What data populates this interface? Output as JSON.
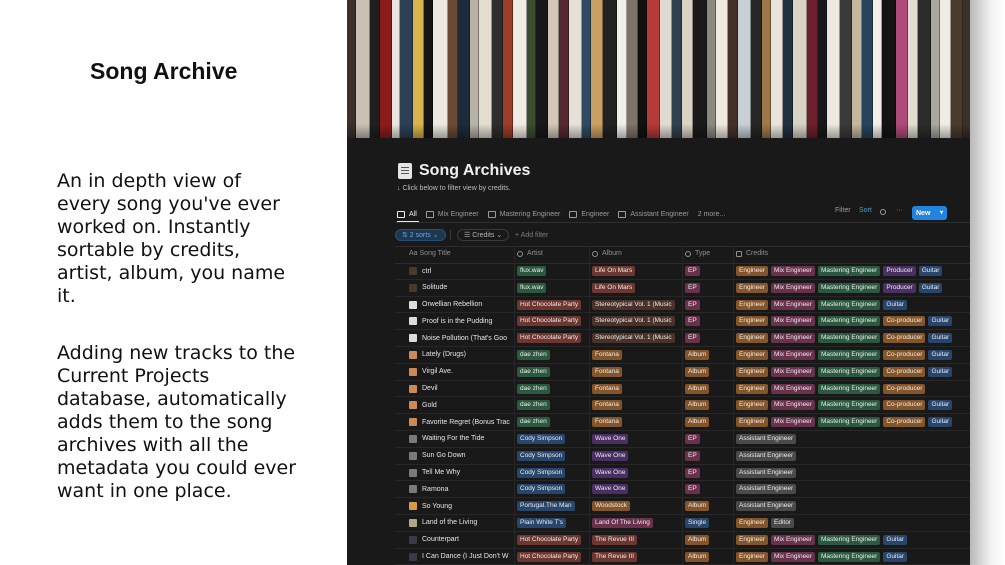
{
  "slide": {
    "title": "Song Archive",
    "paragraph1": "An in depth view of every song you've ever worked on. Instantly sortable by credits, artist, album, you name it.",
    "paragraph2": "Adding new tracks to the Current Projects database, automatically adds them to the song archives with all the metadata you could ever want in one place."
  },
  "cover": {
    "spine_colors": [
      "#3d2f2a",
      "#c9c2b4",
      "#1f1f1f",
      "#8c1c1c",
      "#e9e6df",
      "#2b3f55",
      "#d8b24a",
      "#141414",
      "#ede9e0",
      "#6b4a34",
      "#1c2b3a",
      "#b8b2a6",
      "#e3ddd0",
      "#2d2d2d",
      "#9e3d2a",
      "#f0ece4",
      "#3b4d2f",
      "#181818",
      "#d2c8b7",
      "#572832",
      "#e6e1d7",
      "#2f4a62",
      "#c8a064",
      "#222222",
      "#f1efe9",
      "#7e7467",
      "#111111",
      "#b63a3a",
      "#e0dbd1",
      "#30424f",
      "#dad2c4",
      "#1a1a1a",
      "#8a8a80",
      "#efe9df",
      "#44322a",
      "#c7cfd5",
      "#262626",
      "#9c7a48",
      "#e8e4dc",
      "#1f3040",
      "#d9d3c6",
      "#6e1f2b",
      "#191919",
      "#ede8e0",
      "#3a3a3a",
      "#c3b79f",
      "#27445c",
      "#f2efe8",
      "#141414",
      "#b04a7a",
      "#e2ddd3",
      "#2c2c2c",
      "#a8a8a0",
      "#f0ebe3",
      "#4b3b2d"
    ]
  },
  "page": {
    "title": "Song Archives",
    "subtitle": "↓ Click below to filter view by credits.",
    "tabs": [
      "All",
      "Mix Engineer",
      "Mastering Engineer",
      "Engineer",
      "Assistant Engineer",
      "2 more..."
    ],
    "toolbar": {
      "filter": "Filter",
      "sort": "Sort",
      "more": "···",
      "new": "New"
    },
    "chips": {
      "sorts": "⇅ 2 sorts ⌄",
      "credits": "☰ Credits ⌄",
      "add_filter": "+ Add filter"
    },
    "columns": {
      "title": "Aa Song Title",
      "artist": "Artist",
      "album": "Album",
      "type": "Type",
      "credits": "Credits"
    }
  },
  "colors": {
    "red": "#6e3630",
    "orange": "#85552a",
    "blue": "#28456c",
    "green": "#2b593f",
    "purple": "#492f64",
    "pink": "#69314c",
    "brown": "#4a3228",
    "gray": "#4a4a4a"
  },
  "rows": [
    {
      "title": "ctrl",
      "icon": "#4a3a2a",
      "artist": {
        "t": "flux.wav",
        "c": "green"
      },
      "album": {
        "t": "Life On Mars",
        "c": "red"
      },
      "type": {
        "t": "EP",
        "c": "pink"
      },
      "credits": [
        {
          "t": "Engineer",
          "c": "orange"
        },
        {
          "t": "Mix Engineer",
          "c": "pink"
        },
        {
          "t": "Mastering Engineer",
          "c": "green"
        },
        {
          "t": "Producer",
          "c": "purple"
        },
        {
          "t": "Guitar",
          "c": "blue"
        }
      ]
    },
    {
      "title": "Solitude",
      "icon": "#4a3a2a",
      "artist": {
        "t": "flux.wav",
        "c": "green"
      },
      "album": {
        "t": "Life On Mars",
        "c": "red"
      },
      "type": {
        "t": "EP",
        "c": "pink"
      },
      "credits": [
        {
          "t": "Engineer",
          "c": "orange"
        },
        {
          "t": "Mix Engineer",
          "c": "pink"
        },
        {
          "t": "Mastering Engineer",
          "c": "green"
        },
        {
          "t": "Producer",
          "c": "purple"
        },
        {
          "t": "Guitar",
          "c": "blue"
        }
      ]
    },
    {
      "title": "Orwellian Rebellion",
      "icon": "#dcdcdc",
      "artist": {
        "t": "Hot Chocolate Party",
        "c": "red"
      },
      "album": {
        "t": "Stereotypical Vol. 1 (Music",
        "c": "brown"
      },
      "type": {
        "t": "EP",
        "c": "pink"
      },
      "credits": [
        {
          "t": "Engineer",
          "c": "orange"
        },
        {
          "t": "Mix Engineer",
          "c": "pink"
        },
        {
          "t": "Mastering Engineer",
          "c": "green"
        },
        {
          "t": "Guitar",
          "c": "blue"
        }
      ]
    },
    {
      "title": "Proof is in the Pudding",
      "icon": "#dcdcdc",
      "artist": {
        "t": "Hot Chocolate Party",
        "c": "red"
      },
      "album": {
        "t": "Stereotypical Vol. 1 (Music",
        "c": "brown"
      },
      "type": {
        "t": "EP",
        "c": "pink"
      },
      "credits": [
        {
          "t": "Engineer",
          "c": "orange"
        },
        {
          "t": "Mix Engineer",
          "c": "pink"
        },
        {
          "t": "Mastering Engineer",
          "c": "green"
        },
        {
          "t": "Co-producer",
          "c": "orange"
        },
        {
          "t": "Guitar",
          "c": "blue"
        }
      ]
    },
    {
      "title": "Noise Pollution (That's Goo",
      "icon": "#dcdcdc",
      "artist": {
        "t": "Hot Chocolate Party",
        "c": "red"
      },
      "album": {
        "t": "Stereotypical Vol. 1 (Music",
        "c": "brown"
      },
      "type": {
        "t": "EP",
        "c": "pink"
      },
      "credits": [
        {
          "t": "Engineer",
          "c": "orange"
        },
        {
          "t": "Mix Engineer",
          "c": "pink"
        },
        {
          "t": "Mastering Engineer",
          "c": "green"
        },
        {
          "t": "Co-producer",
          "c": "orange"
        },
        {
          "t": "Guitar",
          "c": "blue"
        }
      ]
    },
    {
      "title": "Lately (Drugs)",
      "icon": "#c98a5a",
      "artist": {
        "t": "dae zhen",
        "c": "green"
      },
      "album": {
        "t": "Fontana",
        "c": "orange"
      },
      "type": {
        "t": "Album",
        "c": "orange"
      },
      "credits": [
        {
          "t": "Engineer",
          "c": "orange"
        },
        {
          "t": "Mix Engineer",
          "c": "pink"
        },
        {
          "t": "Mastering Engineer",
          "c": "green"
        },
        {
          "t": "Co-producer",
          "c": "orange"
        },
        {
          "t": "Guitar",
          "c": "blue"
        }
      ]
    },
    {
      "title": "Virgil Ave.",
      "icon": "#c98a5a",
      "artist": {
        "t": "dae zhen",
        "c": "green"
      },
      "album": {
        "t": "Fontana",
        "c": "orange"
      },
      "type": {
        "t": "Album",
        "c": "orange"
      },
      "credits": [
        {
          "t": "Engineer",
          "c": "orange"
        },
        {
          "t": "Mix Engineer",
          "c": "pink"
        },
        {
          "t": "Mastering Engineer",
          "c": "green"
        },
        {
          "t": "Co-producer",
          "c": "orange"
        },
        {
          "t": "Guitar",
          "c": "blue"
        }
      ]
    },
    {
      "title": "Devil",
      "icon": "#c98a5a",
      "artist": {
        "t": "dae zhen",
        "c": "green"
      },
      "album": {
        "t": "Fontana",
        "c": "orange"
      },
      "type": {
        "t": "Album",
        "c": "orange"
      },
      "credits": [
        {
          "t": "Engineer",
          "c": "orange"
        },
        {
          "t": "Mix Engineer",
          "c": "pink"
        },
        {
          "t": "Mastering Engineer",
          "c": "green"
        },
        {
          "t": "Co-producer",
          "c": "orange"
        }
      ]
    },
    {
      "title": "Gold",
      "icon": "#c98a5a",
      "artist": {
        "t": "dae zhen",
        "c": "green"
      },
      "album": {
        "t": "Fontana",
        "c": "orange"
      },
      "type": {
        "t": "Album",
        "c": "orange"
      },
      "credits": [
        {
          "t": "Engineer",
          "c": "orange"
        },
        {
          "t": "Mix Engineer",
          "c": "pink"
        },
        {
          "t": "Mastering Engineer",
          "c": "green"
        },
        {
          "t": "Co-producer",
          "c": "orange"
        },
        {
          "t": "Guitar",
          "c": "blue"
        }
      ]
    },
    {
      "title": "Favorite Regret (Bonus Trac",
      "icon": "#c98a5a",
      "artist": {
        "t": "dae zhen",
        "c": "green"
      },
      "album": {
        "t": "Fontana",
        "c": "orange"
      },
      "type": {
        "t": "Album",
        "c": "orange"
      },
      "credits": [
        {
          "t": "Engineer",
          "c": "orange"
        },
        {
          "t": "Mix Engineer",
          "c": "pink"
        },
        {
          "t": "Mastering Engineer",
          "c": "green"
        },
        {
          "t": "Co-producer",
          "c": "orange"
        },
        {
          "t": "Guitar",
          "c": "blue"
        }
      ]
    },
    {
      "title": "Waiting For the Tide",
      "icon": "#7a7a7a",
      "artist": {
        "t": "Cody Simpson",
        "c": "blue"
      },
      "album": {
        "t": "Wave One",
        "c": "purple"
      },
      "type": {
        "t": "EP",
        "c": "pink"
      },
      "credits": [
        {
          "t": "Assistant Engineer",
          "c": "gray"
        }
      ]
    },
    {
      "title": "Sun Go Down",
      "icon": "#7a7a7a",
      "artist": {
        "t": "Cody Simpson",
        "c": "blue"
      },
      "album": {
        "t": "Wave One",
        "c": "purple"
      },
      "type": {
        "t": "EP",
        "c": "pink"
      },
      "credits": [
        {
          "t": "Assistant Engineer",
          "c": "gray"
        }
      ]
    },
    {
      "title": "Tell Me Why",
      "icon": "#7a7a7a",
      "artist": {
        "t": "Cody Simpson",
        "c": "blue"
      },
      "album": {
        "t": "Wave One",
        "c": "purple"
      },
      "type": {
        "t": "EP",
        "c": "pink"
      },
      "credits": [
        {
          "t": "Assistant Engineer",
          "c": "gray"
        }
      ]
    },
    {
      "title": "Ramona",
      "icon": "#7a7a7a",
      "artist": {
        "t": "Cody Simpson",
        "c": "blue"
      },
      "album": {
        "t": "Wave One",
        "c": "purple"
      },
      "type": {
        "t": "EP",
        "c": "pink"
      },
      "credits": [
        {
          "t": "Assistant Engineer",
          "c": "gray"
        }
      ]
    },
    {
      "title": "So Young",
      "icon": "#d29a4a",
      "artist": {
        "t": "Portugal.The Man",
        "c": "blue"
      },
      "album": {
        "t": "Woodstock",
        "c": "orange"
      },
      "type": {
        "t": "Album",
        "c": "orange"
      },
      "credits": [
        {
          "t": "Assistant Engineer",
          "c": "gray"
        }
      ]
    },
    {
      "title": "Land of the Living",
      "icon": "#b0a48a",
      "artist": {
        "t": "Plain White T's",
        "c": "blue"
      },
      "album": {
        "t": "Land Of The Living",
        "c": "pink"
      },
      "type": {
        "t": "Single",
        "c": "blue"
      },
      "credits": [
        {
          "t": "Engineer",
          "c": "orange"
        },
        {
          "t": "Editor",
          "c": "gray"
        }
      ]
    },
    {
      "title": "Counterpart",
      "icon": "#3a3a4a",
      "artist": {
        "t": "Hot Chocolate Party",
        "c": "red"
      },
      "album": {
        "t": "The Revue III",
        "c": "red"
      },
      "type": {
        "t": "Album",
        "c": "orange"
      },
      "credits": [
        {
          "t": "Engineer",
          "c": "orange"
        },
        {
          "t": "Mix Engineer",
          "c": "pink"
        },
        {
          "t": "Mastering Engineer",
          "c": "green"
        },
        {
          "t": "Guitar",
          "c": "blue"
        }
      ]
    },
    {
      "title": "I Can Dance (I Just Don't W",
      "icon": "#3a3a4a",
      "artist": {
        "t": "Hot Chocolate Party",
        "c": "red"
      },
      "album": {
        "t": "The Revue III",
        "c": "red"
      },
      "type": {
        "t": "Album",
        "c": "orange"
      },
      "credits": [
        {
          "t": "Engineer",
          "c": "orange"
        },
        {
          "t": "Mix Engineer",
          "c": "pink"
        },
        {
          "t": "Mastering Engineer",
          "c": "green"
        },
        {
          "t": "Guitar",
          "c": "blue"
        }
      ]
    }
  ]
}
